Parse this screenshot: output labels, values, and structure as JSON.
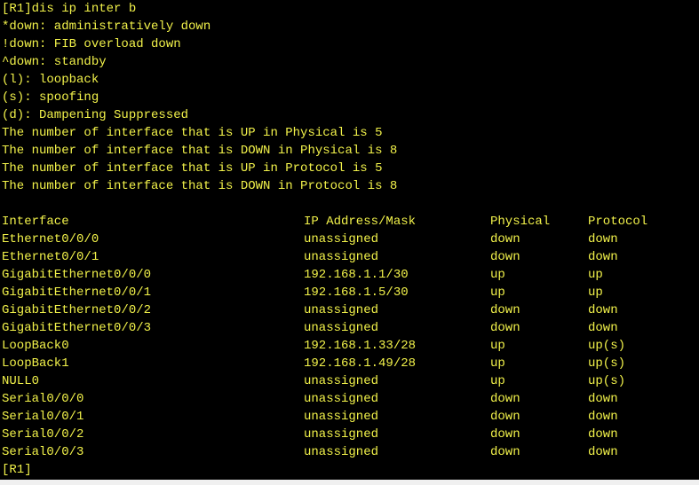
{
  "terminal": {
    "text_color": "#f2f24a",
    "background": "#000000",
    "command_line": "[R1]dis ip inter b",
    "legend": [
      "*down: administratively down",
      "!down: FIB overload down",
      "^down: standby",
      "(l): loopback",
      "(s): spoofing",
      "(d): Dampening Suppressed"
    ],
    "summary": [
      "The number of interface that is UP in Physical is 5",
      "The number of interface that is DOWN in Physical is 8",
      "The number of interface that is UP in Protocol is 5",
      "The number of interface that is DOWN in Protocol is 8"
    ],
    "table": {
      "headers": {
        "interface": "Interface",
        "ip": "IP Address/Mask",
        "physical": "Physical",
        "protocol": "Protocol"
      },
      "rows": [
        {
          "interface": "Ethernet0/0/0",
          "ip": "unassigned",
          "physical": "down",
          "protocol": "down"
        },
        {
          "interface": "Ethernet0/0/1",
          "ip": "unassigned",
          "physical": "down",
          "protocol": "down"
        },
        {
          "interface": "GigabitEthernet0/0/0",
          "ip": "192.168.1.1/30",
          "physical": "up",
          "protocol": "up"
        },
        {
          "interface": "GigabitEthernet0/0/1",
          "ip": "192.168.1.5/30",
          "physical": "up",
          "protocol": "up"
        },
        {
          "interface": "GigabitEthernet0/0/2",
          "ip": "unassigned",
          "physical": "down",
          "protocol": "down"
        },
        {
          "interface": "GigabitEthernet0/0/3",
          "ip": "unassigned",
          "physical": "down",
          "protocol": "down"
        },
        {
          "interface": "LoopBack0",
          "ip": "192.168.1.33/28",
          "physical": "up",
          "protocol": "up(s)"
        },
        {
          "interface": "LoopBack1",
          "ip": "192.168.1.49/28",
          "physical": "up",
          "protocol": "up(s)"
        },
        {
          "interface": "NULL0",
          "ip": "unassigned",
          "physical": "up",
          "protocol": "up(s)"
        },
        {
          "interface": "Serial0/0/0",
          "ip": "unassigned",
          "physical": "down",
          "protocol": "down"
        },
        {
          "interface": "Serial0/0/1",
          "ip": "unassigned",
          "physical": "down",
          "protocol": "down"
        },
        {
          "interface": "Serial0/0/2",
          "ip": "unassigned",
          "physical": "down",
          "protocol": "down"
        },
        {
          "interface": "Serial0/0/3",
          "ip": "unassigned",
          "physical": "down",
          "protocol": "down"
        }
      ]
    },
    "prompt": "[R1]"
  }
}
